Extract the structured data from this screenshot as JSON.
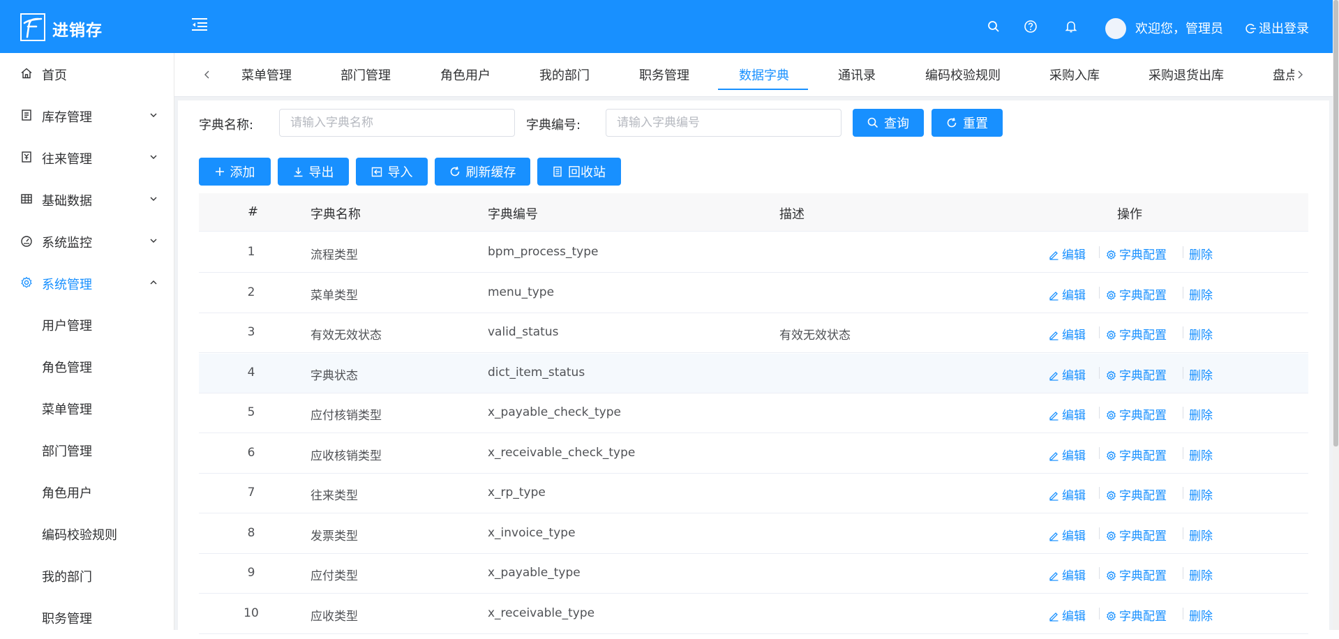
{
  "app": {
    "title": "进销存",
    "welcome": "欢迎您，管理员",
    "logout": "退出登录"
  },
  "colors": {
    "primary": "#1890ff",
    "header_bg": "#1890ff",
    "active_text": "#1890ff"
  },
  "sidebar": {
    "items": [
      {
        "label": "首页",
        "icon": "home-icon"
      },
      {
        "label": "库存管理",
        "icon": "inventory-icon"
      },
      {
        "label": "往来管理",
        "icon": "transaction-icon"
      },
      {
        "label": "基础数据",
        "icon": "grid-icon"
      },
      {
        "label": "系统监控",
        "icon": "dashboard-icon"
      },
      {
        "label": "系统管理",
        "icon": "gear-icon"
      }
    ],
    "sub_items": [
      "用户管理",
      "角色管理",
      "菜单管理",
      "部门管理",
      "角色用户",
      "编码校验规则",
      "我的部门",
      "职务管理"
    ]
  },
  "tabs": [
    "菜单管理",
    "部门管理",
    "角色用户",
    "我的部门",
    "职务管理",
    "数据字典",
    "通讯录",
    "编码校验规则",
    "采购入库",
    "采购退货出库",
    "盘点"
  ],
  "active_tab": "数据字典",
  "search": {
    "name_label": "字典名称:",
    "name_placeholder": "请输入字典名称",
    "code_label": "字典编号:",
    "code_placeholder": "请输入字典编号",
    "query": "查询",
    "reset": "重置"
  },
  "toolbar": {
    "add": "添加",
    "export": "导出",
    "import": "导入",
    "refresh": "刷新缓存",
    "recycle": "回收站"
  },
  "table": {
    "headers": [
      "#",
      "字典名称",
      "字典编号",
      "描述",
      "操作"
    ],
    "actions": {
      "edit": "编辑",
      "config": "字典配置",
      "delete": "删除"
    },
    "rows": [
      {
        "idx": "1",
        "name": "流程类型",
        "code": "bpm_process_type",
        "desc": ""
      },
      {
        "idx": "2",
        "name": "菜单类型",
        "code": "menu_type",
        "desc": ""
      },
      {
        "idx": "3",
        "name": "有效无效状态",
        "code": "valid_status",
        "desc": "有效无效状态"
      },
      {
        "idx": "4",
        "name": "字典状态",
        "code": "dict_item_status",
        "desc": ""
      },
      {
        "idx": "5",
        "name": "应付核销类型",
        "code": "x_payable_check_type",
        "desc": ""
      },
      {
        "idx": "6",
        "name": "应收核销类型",
        "code": "x_receivable_check_type",
        "desc": ""
      },
      {
        "idx": "7",
        "name": "往来类型",
        "code": "x_rp_type",
        "desc": ""
      },
      {
        "idx": "8",
        "name": "发票类型",
        "code": "x_invoice_type",
        "desc": ""
      },
      {
        "idx": "9",
        "name": "应付类型",
        "code": "x_payable_type",
        "desc": ""
      },
      {
        "idx": "10",
        "name": "应收类型",
        "code": "x_receivable_type",
        "desc": ""
      }
    ]
  }
}
